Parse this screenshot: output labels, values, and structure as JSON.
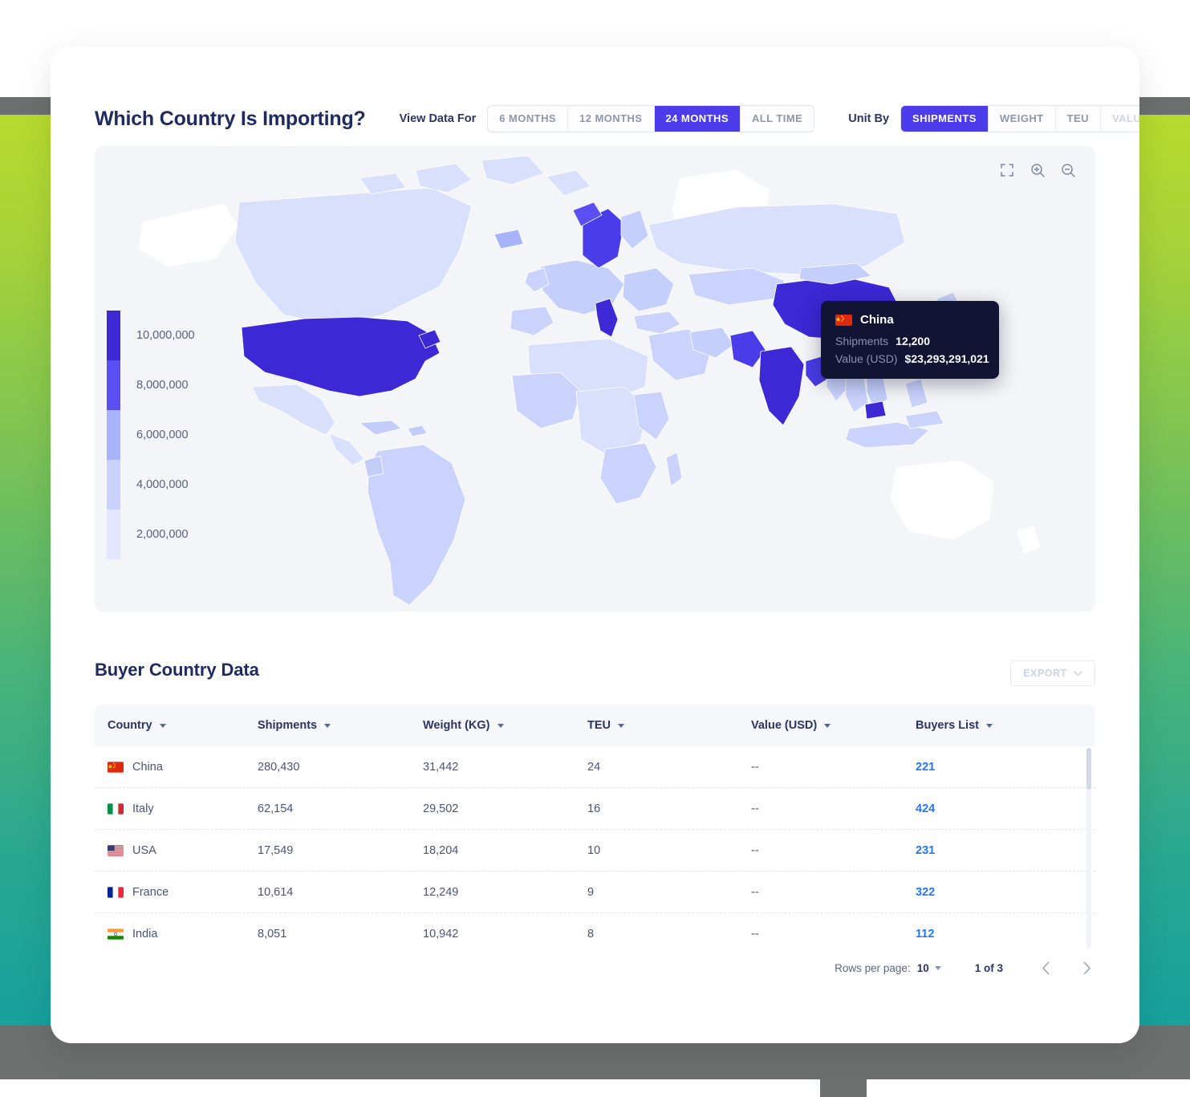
{
  "header": {
    "title": "Which Country Is Importing?",
    "view_data_label": "View Data For",
    "period_options": [
      {
        "label": "6 MONTHS",
        "state": "normal"
      },
      {
        "label": "12 MONTHS",
        "state": "normal"
      },
      {
        "label": "24 MONTHS",
        "state": "active"
      },
      {
        "label": "ALL TIME",
        "state": "normal"
      }
    ],
    "unit_by_label": "Unit By",
    "unit_options": [
      {
        "label": "SHIPMENTS",
        "state": "active"
      },
      {
        "label": "WEIGHT",
        "state": "normal"
      },
      {
        "label": "TEU",
        "state": "normal"
      },
      {
        "label": "VALUE (USD)",
        "state": "disabled"
      }
    ]
  },
  "map": {
    "tools": [
      {
        "name": "fullscreen-icon",
        "label": "Fullscreen"
      },
      {
        "name": "zoom-in-icon",
        "label": "Zoom in"
      },
      {
        "name": "zoom-out-icon",
        "label": "Zoom out"
      }
    ],
    "legend": [
      {
        "value": "10,000,000",
        "color": "#3c28d4"
      },
      {
        "value": "8,000,000",
        "color": "#5b4ef2"
      },
      {
        "value": "6,000,000",
        "color": "#a7b3fb"
      },
      {
        "value": "4,000,000",
        "color": "#c9d2fd"
      },
      {
        "value": "2,000,000",
        "color": "#e2e7fe"
      }
    ],
    "tooltip": {
      "country": "China",
      "flag": "cn",
      "rows": [
        {
          "key": "Shipments",
          "value": "12,200"
        },
        {
          "key": "Value (USD)",
          "value": "$23,293,291,021"
        }
      ]
    }
  },
  "table": {
    "title": "Buyer Country Data",
    "export_label": "EXPORT",
    "columns": [
      {
        "label": "Country",
        "key": "country"
      },
      {
        "label": "Shipments",
        "key": "shipments"
      },
      {
        "label": "Weight (KG)",
        "key": "weight"
      },
      {
        "label": "TEU",
        "key": "teu"
      },
      {
        "label": "Value (USD)",
        "key": "value"
      },
      {
        "label": "Buyers List",
        "key": "buyers"
      }
    ],
    "rows": [
      {
        "country": "China",
        "flag": "cn",
        "shipments": "280,430",
        "weight": "31,442",
        "teu": "24",
        "value": "--",
        "buyers": "221"
      },
      {
        "country": "Italy",
        "flag": "it",
        "shipments": "62,154",
        "weight": "29,502",
        "teu": "16",
        "value": "--",
        "buyers": "424"
      },
      {
        "country": "USA",
        "flag": "us",
        "shipments": "17,549",
        "weight": "18,204",
        "teu": "10",
        "value": "--",
        "buyers": "231"
      },
      {
        "country": "France",
        "flag": "fr",
        "shipments": "10,614",
        "weight": "12,249",
        "teu": "9",
        "value": "--",
        "buyers": "322"
      },
      {
        "country": "India",
        "flag": "in",
        "shipments": "8,051",
        "weight": "10,942",
        "teu": "8",
        "value": "--",
        "buyers": "112"
      }
    ]
  },
  "pagination": {
    "rows_per_page_label": "Rows per page:",
    "rows_per_page_value": "10",
    "page_indicator": "1 of 3",
    "prev_label": "Previous page",
    "next_label": "Next page"
  },
  "colors": {
    "accent": "#4c3ceb",
    "title": "#1f2a60",
    "link": "#2176f4",
    "tooltip_bg": "#111533"
  }
}
